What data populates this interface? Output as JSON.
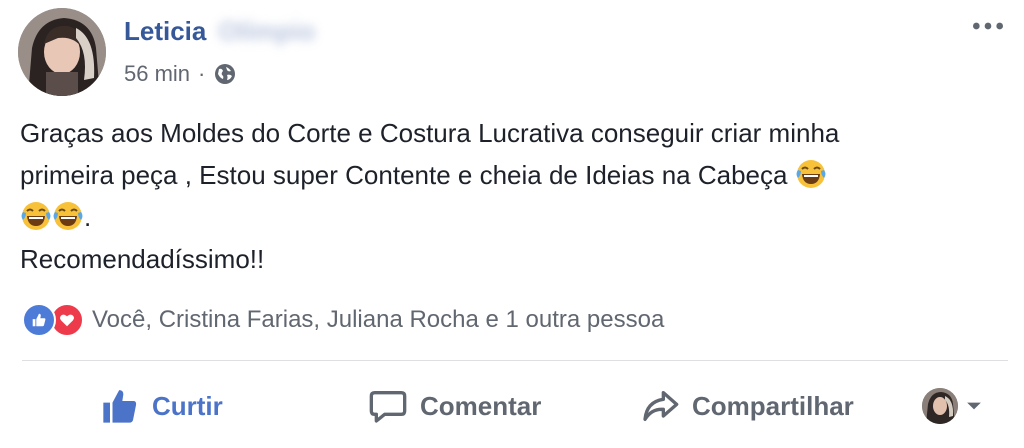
{
  "post": {
    "author_first": "Leticia",
    "author_last": "Olímpio",
    "time": "56 min",
    "separator": "·",
    "privacy_icon": "globe-icon",
    "text_line1": "Graças aos Moldes do Corte e Costura Lucrativa conseguir criar minha",
    "text_line2": "primeira peça , Estou super Contente e cheia de Ideias na Cabeça ",
    "text_line3_end": ".",
    "text_line4": "Recomendadíssimo!!",
    "emoji_name": "tears-of-joy-emoji"
  },
  "reactions": {
    "icons": [
      "like-icon",
      "love-icon"
    ],
    "names": "Você, Cristina Farias, Juliana Rocha e 1 outra pessoa"
  },
  "actions": {
    "like": "Curtir",
    "comment": "Comentar",
    "share": "Compartilhar"
  },
  "colors": {
    "author": "#365899",
    "like_active": "#4b74c9",
    "like_reaction": "#4d7bd8",
    "love_reaction": "#ee3b4c",
    "muted": "#616770"
  }
}
